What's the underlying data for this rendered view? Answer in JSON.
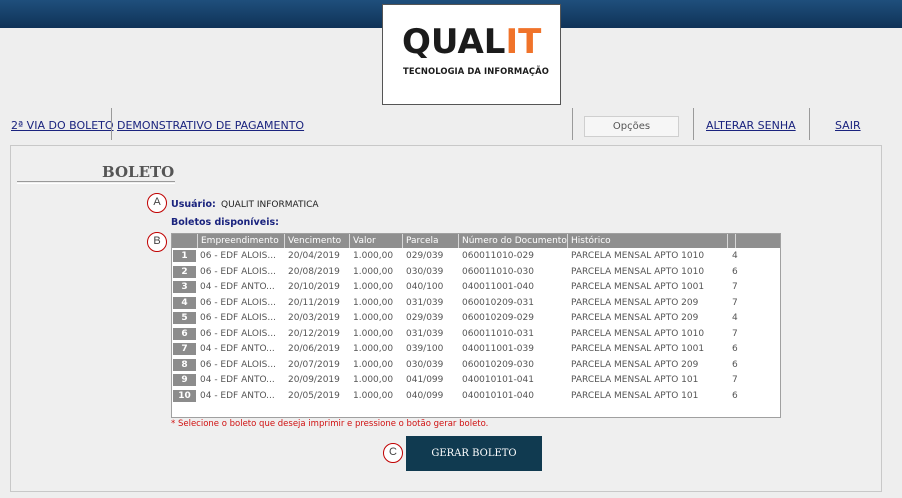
{
  "logo": {
    "brand_main": "QUAL",
    "brand_accent": "IT",
    "tagline": "TECNOLOGIA DA INFORMAÇÃO",
    "accent_color": "#f0732a"
  },
  "nav": {
    "segunda_via": "2ª VIA DO BOLETO",
    "demonstrativo": "DEMONSTRATIVO DE PAGAMENTO",
    "opcoes": "Opções",
    "alterar_senha": "ALTERAR SENHA",
    "sair": "SAIR"
  },
  "page": {
    "title": "BOLETO"
  },
  "markers": {
    "a": "A",
    "b": "B",
    "c": "C",
    "color": "#c00000"
  },
  "user": {
    "label": "Usuário:",
    "value": "QUALIT INFORMATICA"
  },
  "boletos": {
    "label": "Boletos disponíveis:",
    "columns": [
      "Empreendimento",
      "Vencimento",
      "Valor",
      "Parcela",
      "Número do Documento",
      "Histórico",
      "",
      ""
    ],
    "rows": [
      {
        "n": "1",
        "emp": "06 - EDF ALOIS...",
        "venc": "20/04/2019",
        "valor": "1.000,00",
        "parcela": "029/039",
        "doc": "060011010-029",
        "hist": "PARCELA MENSAL APTO 1010",
        "extra": "4"
      },
      {
        "n": "2",
        "emp": "06 - EDF ALOIS...",
        "venc": "20/08/2019",
        "valor": "1.000,00",
        "parcela": "030/039",
        "doc": "060011010-030",
        "hist": "PARCELA MENSAL APTO 1010",
        "extra": "6"
      },
      {
        "n": "3",
        "emp": "04 - EDF ANTO...",
        "venc": "20/10/2019",
        "valor": "1.000,00",
        "parcela": "040/100",
        "doc": "040011001-040",
        "hist": "PARCELA MENSAL APTO 1001",
        "extra": "7"
      },
      {
        "n": "4",
        "emp": "06 - EDF ALOIS...",
        "venc": "20/11/2019",
        "valor": "1.000,00",
        "parcela": "031/039",
        "doc": "060010209-031",
        "hist": "PARCELA MENSAL APTO 209",
        "extra": "7"
      },
      {
        "n": "5",
        "emp": "06 - EDF ALOIS...",
        "venc": "20/03/2019",
        "valor": "1.000,00",
        "parcela": "029/039",
        "doc": "060010209-029",
        "hist": "PARCELA MENSAL APTO 209",
        "extra": "4"
      },
      {
        "n": "6",
        "emp": "06 - EDF ALOIS...",
        "venc": "20/12/2019",
        "valor": "1.000,00",
        "parcela": "031/039",
        "doc": "060011010-031",
        "hist": "PARCELA MENSAL APTO 1010",
        "extra": "7"
      },
      {
        "n": "7",
        "emp": "04 - EDF ANTO...",
        "venc": "20/06/2019",
        "valor": "1.000,00",
        "parcela": "039/100",
        "doc": "040011001-039",
        "hist": "PARCELA MENSAL APTO 1001",
        "extra": "6"
      },
      {
        "n": "8",
        "emp": "06 - EDF ALOIS...",
        "venc": "20/07/2019",
        "valor": "1.000,00",
        "parcela": "030/039",
        "doc": "060010209-030",
        "hist": "PARCELA MENSAL APTO 209",
        "extra": "6"
      },
      {
        "n": "9",
        "emp": "04 - EDF ANTO...",
        "venc": "20/09/2019",
        "valor": "1.000,00",
        "parcela": "041/099",
        "doc": "040010101-041",
        "hist": "PARCELA MENSAL APTO 101",
        "extra": "7"
      },
      {
        "n": "10",
        "emp": "04 - EDF ANTO...",
        "venc": "20/05/2019",
        "valor": "1.000,00",
        "parcela": "040/099",
        "doc": "040010101-040",
        "hist": "PARCELA MENSAL APTO 101",
        "extra": "6"
      }
    ]
  },
  "instruction": "* Selecione o boleto que deseja imprimir e pressione o botão gerar boleto.",
  "button": {
    "label": "GERAR BOLETO"
  }
}
